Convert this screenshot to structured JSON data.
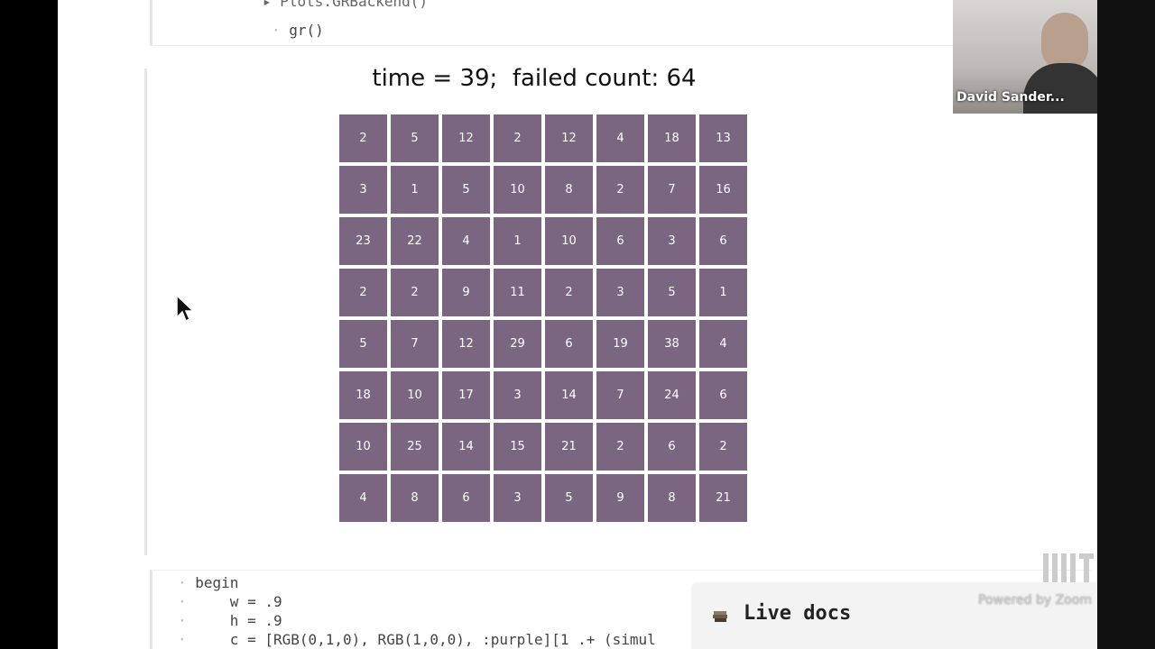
{
  "top_cell": {
    "collapsed_line": "▸ Plots.GRBackend()",
    "code_line": "gr()"
  },
  "plot": {
    "title": "time = 39;  failed count: 64",
    "tile_color": "#7b6682",
    "grid": [
      [
        2,
        5,
        12,
        2,
        12,
        4,
        18,
        13
      ],
      [
        3,
        1,
        5,
        10,
        8,
        2,
        7,
        16
      ],
      [
        23,
        22,
        4,
        1,
        10,
        6,
        3,
        6
      ],
      [
        2,
        2,
        9,
        11,
        2,
        3,
        5,
        1
      ],
      [
        5,
        7,
        12,
        29,
        6,
        19,
        38,
        4
      ],
      [
        18,
        10,
        17,
        3,
        14,
        7,
        24,
        6
      ],
      [
        10,
        25,
        14,
        15,
        21,
        2,
        6,
        2
      ],
      [
        4,
        8,
        6,
        3,
        5,
        9,
        8,
        21
      ]
    ]
  },
  "bottom_cell": {
    "lines": [
      "begin",
      "    w = .9",
      "    h = .9",
      "    c = [RGB(0,1,0), RGB(1,0,0), :purple][1 .+ (simul"
    ]
  },
  "live_docs": {
    "label": "Live docs"
  },
  "webcam": {
    "name": "David Sander..."
  },
  "watermark": {
    "powered": "Powered by Zoom"
  }
}
